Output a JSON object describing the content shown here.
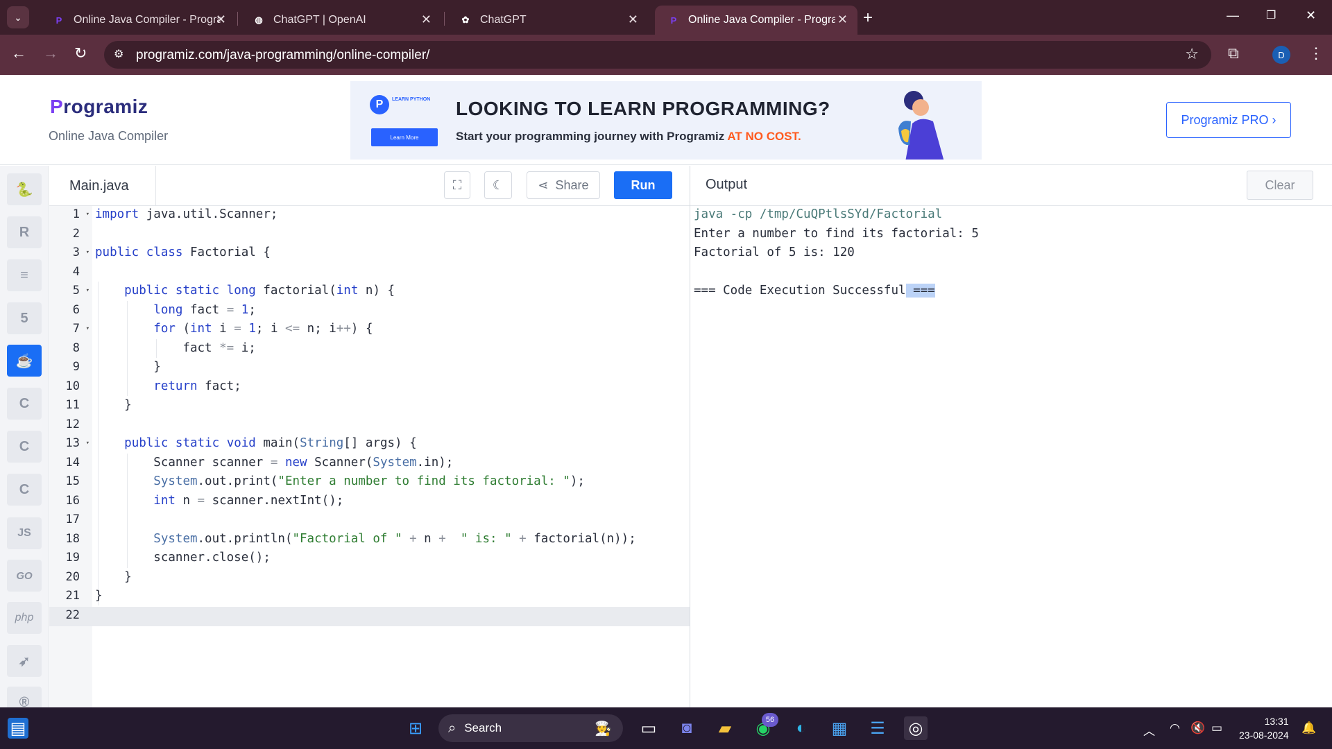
{
  "browser": {
    "tabs": [
      {
        "title": "Online Java Compiler - Programiz",
        "active": false
      },
      {
        "title": "ChatGPT | OpenAI",
        "active": false
      },
      {
        "title": "ChatGPT",
        "active": false
      },
      {
        "title": "Online Java Compiler - Programiz",
        "active": true
      }
    ],
    "url": "programiz.com/java-programming/online-compiler/",
    "profile_initial": "D"
  },
  "site": {
    "logo": "rogramiz",
    "logo_p": "P",
    "subtitle": "Online Java Compiler",
    "banner": {
      "badge_title": "LEARN PYTHON",
      "badge_button": "Learn More",
      "headline": "LOOKING TO LEARN PROGRAMMING?",
      "tagline": "Start your programming journey with Programiz ",
      "tagline_highlight": "AT NO COST."
    },
    "pro_button": "Programiz PRO ›"
  },
  "rail": {
    "items": [
      {
        "name": "python-icon",
        "glyph": "🐍",
        "active": false
      },
      {
        "name": "r-icon",
        "glyph": "R",
        "active": false
      },
      {
        "name": "sql-icon",
        "glyph": "≡",
        "active": false
      },
      {
        "name": "html-icon",
        "glyph": "5",
        "active": false
      },
      {
        "name": "java-icon",
        "glyph": "☕",
        "active": true
      },
      {
        "name": "c-icon",
        "glyph": "C",
        "active": false
      },
      {
        "name": "cpp-icon",
        "glyph": "C",
        "active": false
      },
      {
        "name": "csharp-icon",
        "glyph": "C",
        "active": false
      },
      {
        "name": "js-icon",
        "glyph": "JS",
        "active": false
      },
      {
        "name": "go-icon",
        "glyph": "GO",
        "active": false
      },
      {
        "name": "php-icon",
        "glyph": "php",
        "active": false
      },
      {
        "name": "swift-icon",
        "glyph": "➶",
        "active": false
      },
      {
        "name": "rust-icon",
        "glyph": "®",
        "active": false
      }
    ]
  },
  "editor": {
    "file_name": "Main.java",
    "share_label": "Share",
    "run_label": "Run",
    "line_numbers": [
      "1",
      "2",
      "3",
      "4",
      "5",
      "6",
      "7",
      "8",
      "9",
      "10",
      "11",
      "12",
      "13",
      "14",
      "15",
      "16",
      "17",
      "18",
      "19",
      "20",
      "21",
      "22"
    ],
    "folds": [
      "1",
      "3",
      "5",
      "7",
      "13"
    ]
  },
  "output": {
    "title": "Output",
    "clear_label": "Clear",
    "lines": [
      "java -cp /tmp/CuQPtlsSYd/Factorial",
      "Enter a number to find its factorial: 5",
      "Factorial of 5 is: 120",
      "",
      "=== Code Execution Successful"
    ],
    "selected_tail": " ==="
  },
  "taskbar": {
    "search_label": "Search",
    "whatsapp_badge": "56",
    "time": "13:31",
    "date": "23-08-2024"
  }
}
